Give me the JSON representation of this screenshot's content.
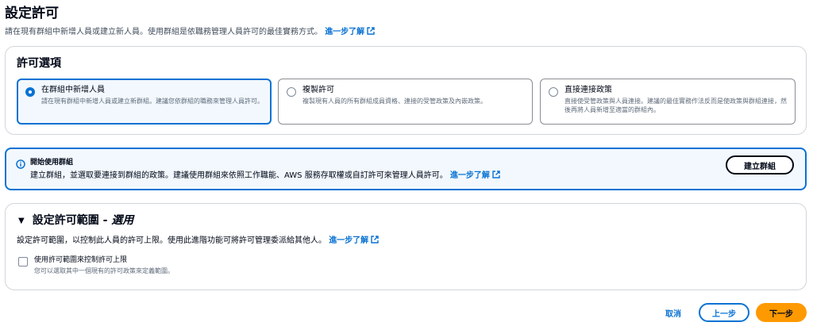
{
  "header": {
    "title": "設定許可",
    "description": "請在現有群組中新增人員或建立新人員。使用群組是依職務管理人員許可的最佳實務方式。",
    "learn_more": "進一步了解"
  },
  "permission_options": {
    "title": "許可選項",
    "options": [
      {
        "label": "在群組中新增人員",
        "description": "請在現有群組中新增人員或建立新群組。建議您依群組的職務來管理人員許可。",
        "selected": true
      },
      {
        "label": "複製許可",
        "description": "複製現有人員的所有群組成員資格、連接的受管政策及內嵌政策。",
        "selected": false
      },
      {
        "label": "直接連接政策",
        "description": "直接使受管政策與人員連接。建議的最佳實務作法反而是使政策與群組連接，然後再將人員新增至適當的群組內。",
        "selected": false
      }
    ]
  },
  "info_alert": {
    "title": "開始使用群組",
    "body": "建立群組，並選取要連接到群組的政策。建議使用群組來依照工作職能、AWS 服務存取權或自訂許可來管理人員許可。",
    "learn_more": "進一步了解",
    "button": "建立群組"
  },
  "boundary": {
    "title": "設定許可範圍 - ",
    "optional": "選用",
    "description": "設定許可範圍，以控制此人員的許可上限。使用此進階功能可將許可管理委派給其他人。",
    "learn_more": "進一步了解",
    "checkbox_label": "使用許可範圍來控制許可上限",
    "checkbox_desc": "您可以選取其中一個現有的許可政策來定義範圍。",
    "checked": false
  },
  "footer": {
    "cancel": "取消",
    "previous": "上一步",
    "next": "下一步"
  },
  "colors": {
    "accent": "#0972d3",
    "primary_button": "#ff9900",
    "info_background": "#f2f8fd"
  }
}
